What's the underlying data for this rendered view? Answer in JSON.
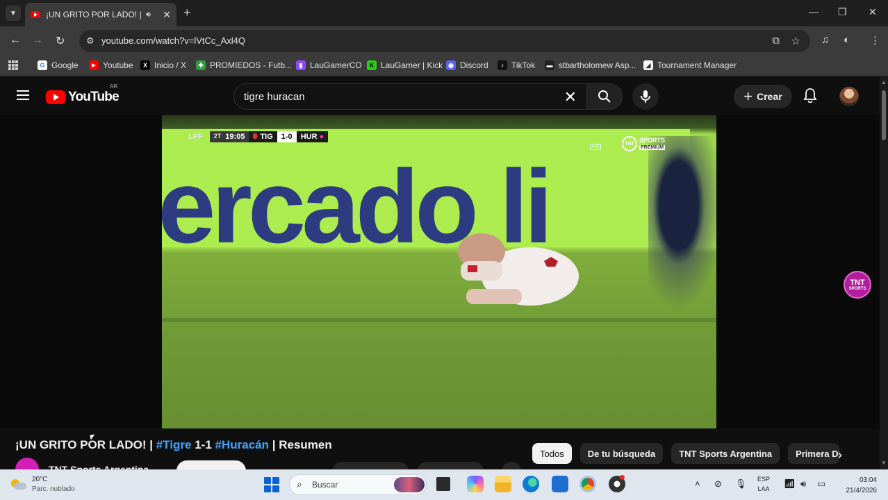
{
  "browser": {
    "tab": {
      "title": "¡UN GRITO POR LADO! | #Ti"
    },
    "url": "youtube.com/watch?v=lVtCc_Axl4Q",
    "bookmarks": [
      {
        "label": "Google",
        "color": "#ffffff",
        "glyph": "G"
      },
      {
        "label": "Youtube",
        "color": "#ff0000",
        "glyph": "▶"
      },
      {
        "label": "Inicio / X",
        "color": "#000000",
        "glyph": "X"
      },
      {
        "label": "PROMIEDOS - Futb...",
        "color": "#2e9e3e",
        "glyph": "✚"
      },
      {
        "label": "LauGamerCO",
        "color": "#9146ff",
        "glyph": "▮"
      },
      {
        "label": "LauGamer | Kick",
        "color": "#29d10f",
        "glyph": "K"
      },
      {
        "label": "Discord",
        "color": "#5865f2",
        "glyph": "◉"
      },
      {
        "label": "TikTok",
        "color": "#111111",
        "glyph": "♪"
      },
      {
        "label": "stbartholomew Asp...",
        "color": "#222222",
        "glyph": "▬"
      },
      {
        "label": "Tournament Manager",
        "color": "#ffffff",
        "glyph": "◢"
      }
    ]
  },
  "youtube": {
    "wordmark": "YouTube",
    "region": "AR",
    "search_query": "tigre huracan",
    "create_label": "Crear"
  },
  "video": {
    "scorebug": {
      "league": "LPF",
      "half": "2T",
      "clock": "19:05",
      "home": "TIG",
      "score": "1-0",
      "away": "HUR"
    },
    "broadcaster": {
      "logo": "TNT",
      "name": "SPORTS",
      "tier": "PREMIUM"
    },
    "hd_tag": "HD",
    "ad_text": "ercado li"
  },
  "watch": {
    "title_parts": {
      "a": "¡UN GRITO POR LADO! | ",
      "b": "#Tigre",
      "c": " 1-1 ",
      "d": "#Huracán",
      "e": " | Resumen"
    },
    "channel": "TNT Sports Argentina",
    "float_logo": "TNT",
    "float_sub": "SPORTS",
    "chips": [
      "Todos",
      "De tu búsqueda",
      "TNT Sports Argentina",
      "Primera Div"
    ]
  },
  "taskbar": {
    "weather_temp": "20°C",
    "weather_desc": "Parc. nublado",
    "search_label": "Buscar",
    "lang_1": "ESP",
    "lang_2": "LAA",
    "time": "03:04",
    "date": "21/4/2026"
  }
}
